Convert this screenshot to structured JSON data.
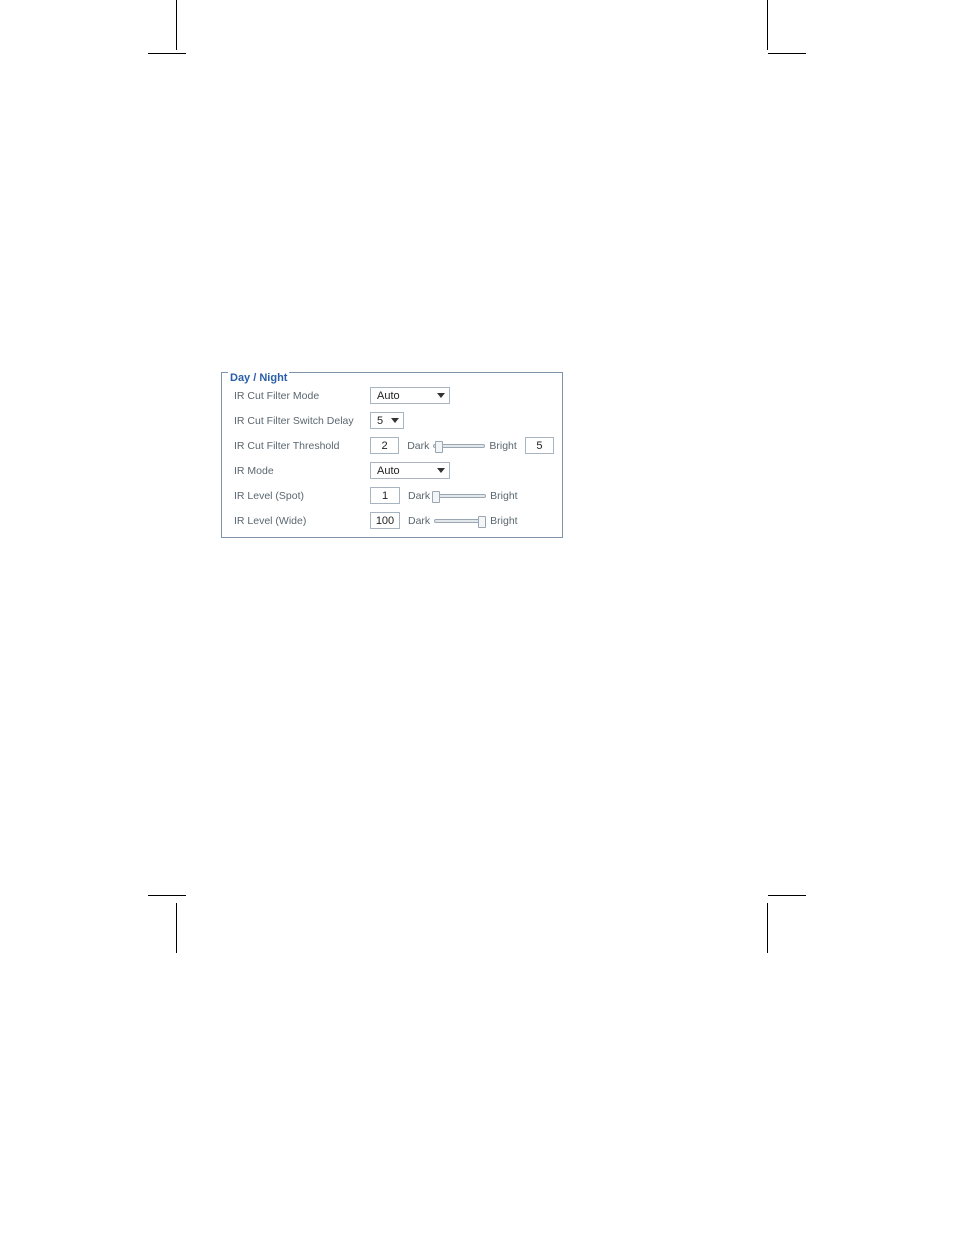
{
  "panel": {
    "legend": "Day / Night",
    "rows": {
      "ir_cut_filter_mode": {
        "label": "IR Cut Filter Mode",
        "value": "Auto"
      },
      "ir_cut_filter_switch_delay": {
        "label": "IR Cut Filter Switch Delay",
        "value": "5"
      },
      "ir_cut_filter_threshold": {
        "label": "IR Cut Filter Threshold",
        "value_left": "2",
        "dark": "Dark",
        "bright": "Bright",
        "value_right": "5"
      },
      "ir_mode": {
        "label": "IR Mode",
        "value": "Auto"
      },
      "ir_level_spot": {
        "label": "IR Level (Spot)",
        "value": "1",
        "dark": "Dark",
        "bright": "Bright"
      },
      "ir_level_wide": {
        "label": "IR Level (Wide)",
        "value": "100",
        "dark": "Dark",
        "bright": "Bright"
      }
    }
  }
}
